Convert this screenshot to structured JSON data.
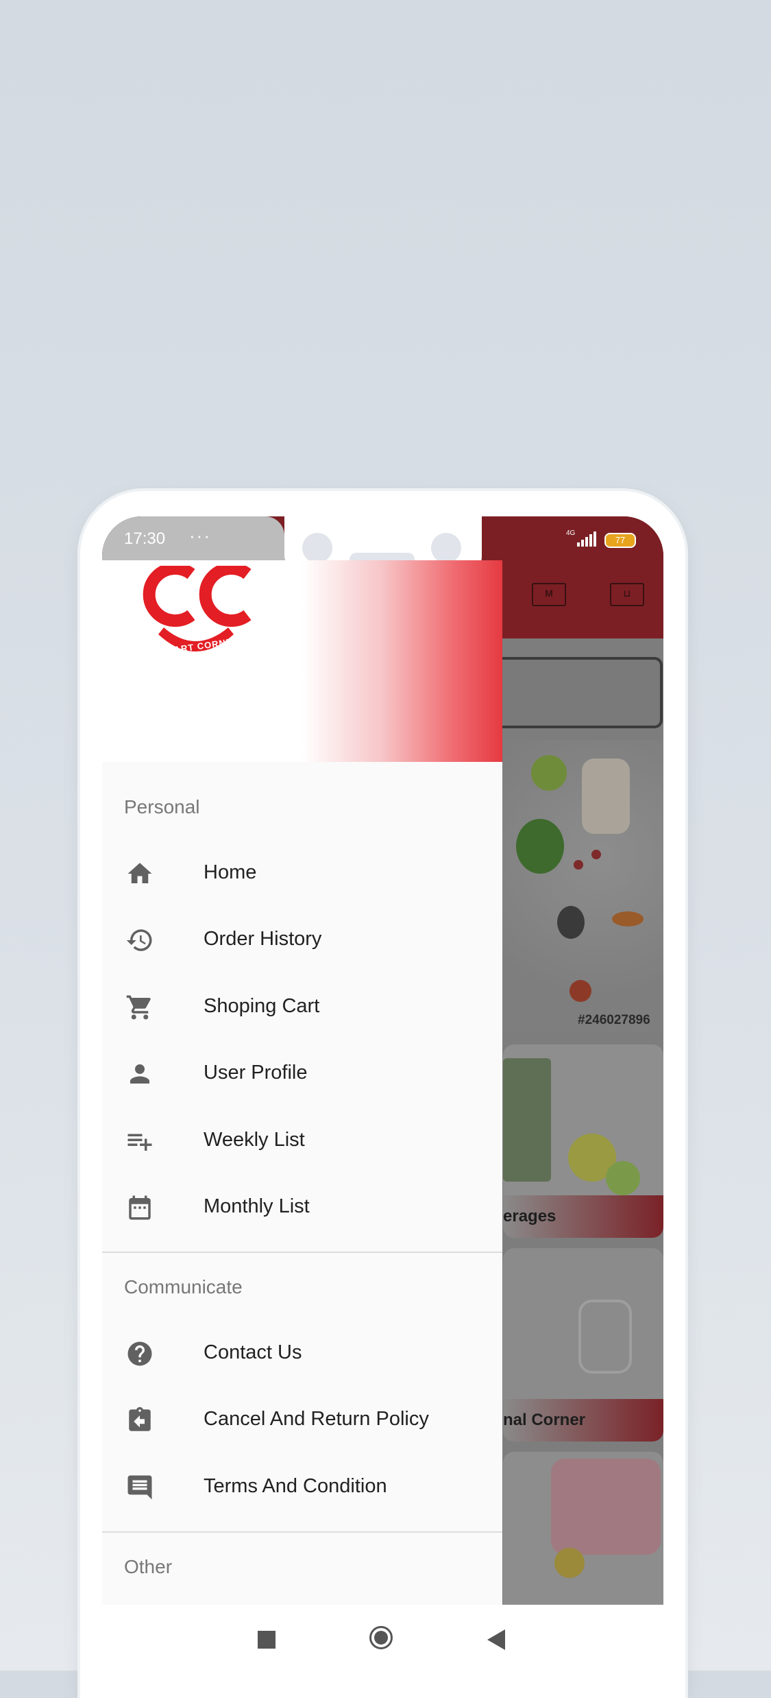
{
  "status_bar": {
    "time": "17:30",
    "more": "···",
    "network": "4G",
    "battery": "77"
  },
  "background_app": {
    "tile_labels": [
      "erages",
      "nal Corner"
    ],
    "image_code": "#246027896"
  },
  "drawer": {
    "logo_text": "CART CORNER",
    "sections": [
      {
        "title": "Personal",
        "items": [
          {
            "label": "Home",
            "icon": "home-icon"
          },
          {
            "label": "Order History",
            "icon": "history-icon"
          },
          {
            "label": "Shoping Cart",
            "icon": "cart-icon"
          },
          {
            "label": "User Profile",
            "icon": "person-icon"
          },
          {
            "label": "Weekly List",
            "icon": "playlist-add-icon"
          },
          {
            "label": "Monthly List",
            "icon": "calendar-icon"
          }
        ]
      },
      {
        "title": "Communicate",
        "items": [
          {
            "label": "Contact Us",
            "icon": "help-icon"
          },
          {
            "label": "Cancel And Return Policy",
            "icon": "clipboard-return-icon"
          },
          {
            "label": "Terms And Condition",
            "icon": "comment-icon"
          }
        ]
      },
      {
        "title": "Other",
        "items": []
      }
    ]
  },
  "colors": {
    "brand_red": "#e31e24",
    "app_bar_dimmed": "#7b1f24",
    "drawer_bg": "#fafafa",
    "icon_gray": "#616161"
  }
}
